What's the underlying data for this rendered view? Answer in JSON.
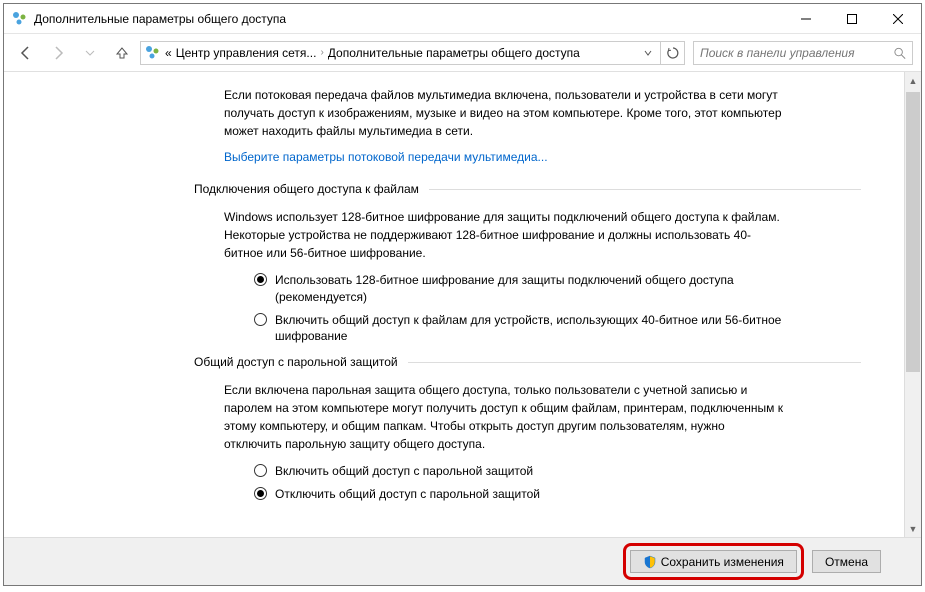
{
  "window": {
    "title": "Дополнительные параметры общего доступа"
  },
  "breadcrumb": {
    "prefix": "«",
    "seg1": "Центр управления сетя...",
    "seg2": "Дополнительные параметры общего доступа"
  },
  "search": {
    "placeholder": "Поиск в панели управления"
  },
  "intro": {
    "text": "Если потоковая передача файлов мультимедиа включена, пользователи и устройства в сети могут получать доступ к изображениям, музыке и видео на этом компьютере. Кроме того, этот компьютер может находить файлы мультимедиа в сети.",
    "link": "Выберите параметры потоковой передачи мультимедиа..."
  },
  "section_encryption": {
    "title": "Подключения общего доступа к файлам",
    "desc": "Windows использует 128-битное шифрование для защиты подключений общего доступа к файлам. Некоторые устройства не поддерживают 128-битное шифрование и должны использовать 40-битное или 56-битное шифрование.",
    "opt1": "Использовать 128-битное шифрование для защиты подключений общего доступа (рекомендуется)",
    "opt2": "Включить общий доступ к файлам для устройств, использующих 40-битное или 56-битное шифрование"
  },
  "section_password": {
    "title": "Общий доступ с парольной защитой",
    "desc": "Если включена парольная защита общего доступа, только пользователи с учетной записью и паролем на этом компьютере могут получить доступ к общим файлам, принтерам, подключенным к этому компьютеру, и общим папкам. Чтобы открыть доступ другим пользователям, нужно отключить парольную защиту общего доступа.",
    "opt1": "Включить общий доступ с парольной защитой",
    "opt2": "Отключить общий доступ с парольной защитой"
  },
  "footer": {
    "save": "Сохранить изменения",
    "cancel": "Отмена"
  }
}
